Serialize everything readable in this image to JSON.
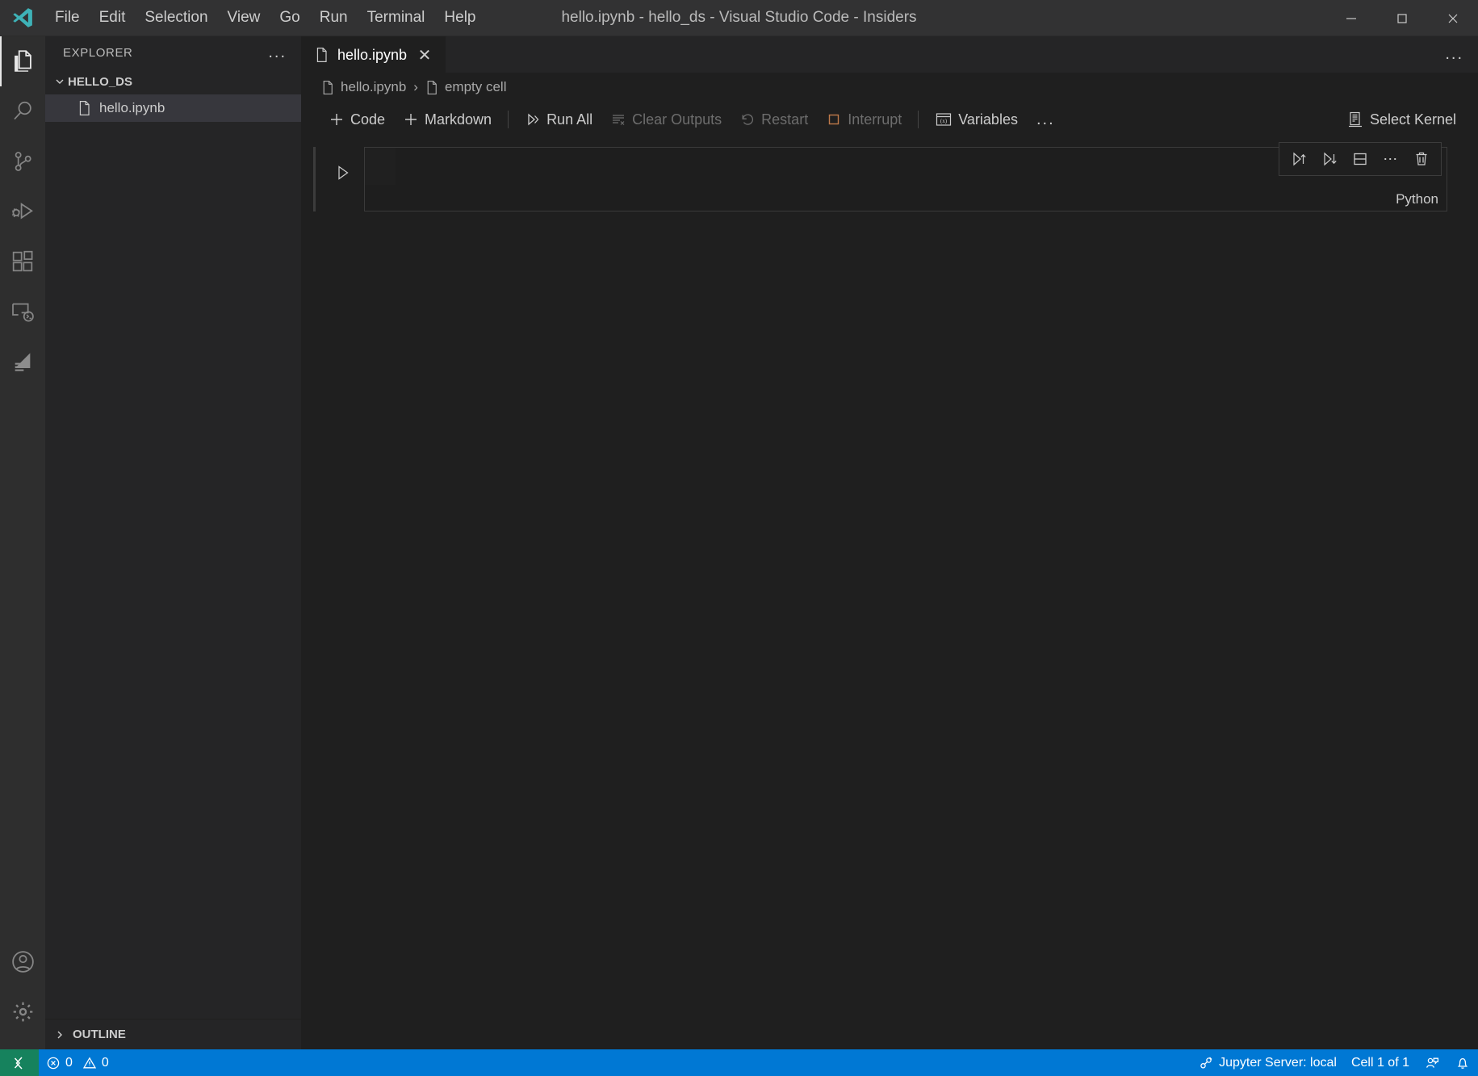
{
  "window": {
    "title": "hello.ipynb - hello_ds - Visual Studio Code - Insiders",
    "minimize_label": "Minimize",
    "maximize_label": "Maximize",
    "close_label": "Close"
  },
  "menubar": {
    "items": [
      {
        "label": "File"
      },
      {
        "label": "Edit"
      },
      {
        "label": "Selection"
      },
      {
        "label": "View"
      },
      {
        "label": "Go"
      },
      {
        "label": "Run"
      },
      {
        "label": "Terminal"
      },
      {
        "label": "Help"
      }
    ]
  },
  "activitybar": {
    "top": [
      {
        "name": "explorer",
        "icon": "files-icon",
        "active": true
      },
      {
        "name": "search",
        "icon": "search-icon",
        "active": false
      },
      {
        "name": "source-control",
        "icon": "source-control-icon",
        "active": false
      },
      {
        "name": "run-and-debug",
        "icon": "run-debug-icon",
        "active": false
      },
      {
        "name": "extensions",
        "icon": "extensions-icon",
        "active": false
      },
      {
        "name": "remote-explorer",
        "icon": "remote-explorer-icon",
        "active": false
      },
      {
        "name": "jupyter",
        "icon": "jupyter-icon",
        "active": false
      }
    ],
    "bottom": [
      {
        "name": "accounts",
        "icon": "account-icon"
      },
      {
        "name": "settings",
        "icon": "gear-icon"
      }
    ]
  },
  "sidebar": {
    "title": "EXPLORER",
    "more_actions": "...",
    "folder": "HELLO_DS",
    "files": [
      {
        "label": "hello.ipynb",
        "selected": true
      }
    ],
    "outline_label": "OUTLINE"
  },
  "editor": {
    "tab": {
      "label": "hello.ipynb",
      "close": "✕"
    },
    "more_actions": "...",
    "breadcrumbs": [
      {
        "label": "hello.ipynb"
      },
      {
        "label": "empty cell"
      }
    ],
    "breadcrumb_separator": "›"
  },
  "notebook_toolbar": {
    "buttons": [
      {
        "label": "Code",
        "icon": "plus-icon",
        "disabled": false
      },
      {
        "label": "Markdown",
        "icon": "plus-icon",
        "disabled": false
      },
      {
        "label": "Run All",
        "icon": "run-all-icon",
        "disabled": false
      },
      {
        "label": "Clear Outputs",
        "icon": "clear-outputs-icon",
        "disabled": true
      },
      {
        "label": "Restart",
        "icon": "restart-icon",
        "disabled": true
      },
      {
        "label": "Interrupt",
        "icon": "interrupt-icon",
        "disabled": true
      },
      {
        "label": "Variables",
        "icon": "variables-icon",
        "disabled": false
      }
    ],
    "more_actions": "...",
    "select_kernel": {
      "label": "Select Kernel",
      "icon": "kernel-icon"
    }
  },
  "cell": {
    "run_label": "Execute cell",
    "language": "Python",
    "code": "",
    "toolbar": [
      {
        "name": "run-above",
        "icon": "run-above-icon"
      },
      {
        "name": "run-below",
        "icon": "run-below-icon"
      },
      {
        "name": "split-cell",
        "icon": "split-cell-icon"
      },
      {
        "name": "more-actions",
        "icon": "more-icon"
      },
      {
        "name": "delete-cell",
        "icon": "trash-icon"
      }
    ]
  },
  "statusbar": {
    "remote_icon": "remote-icon",
    "errors": "0",
    "warnings": "0",
    "jupyter_server": "Jupyter Server: local",
    "cell_position": "Cell 1 of 1",
    "feedback_icon": "feedback-icon",
    "bell_icon": "bell-icon"
  },
  "colors": {
    "accent": "#0078d4",
    "remote_green": "#16825d",
    "titlebar_bg": "#323233",
    "sidebar_bg": "#252526",
    "editor_bg": "#1f1f1f",
    "activitybar_bg": "#2e2e2e",
    "interrupt_orange": "#c07a4a"
  }
}
